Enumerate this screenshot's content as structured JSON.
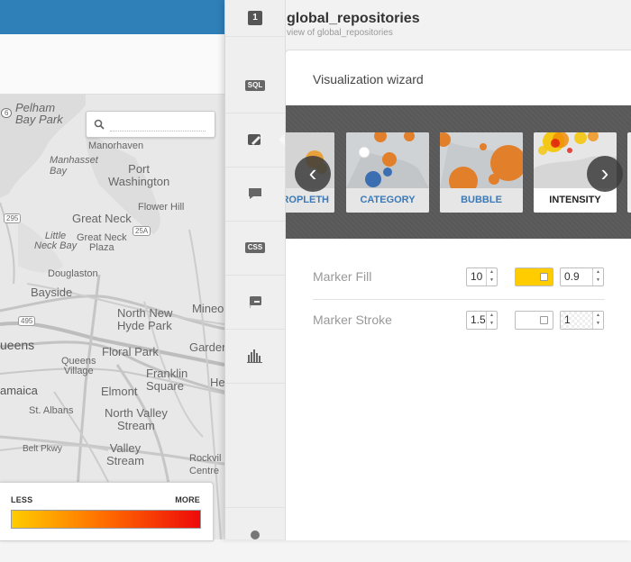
{
  "map": {
    "labels": {
      "pelham_bay_park": "Pelham\nBay Park",
      "manorhaven": "Manorhaven",
      "manhasset_bay": "Manhasset\nBay",
      "port_washington": "Port\nWashington",
      "flower_hill": "Flower Hill",
      "great_neck": "Great Neck",
      "little_neck_bay": "Little\nNeck Bay",
      "great_neck_plaza": "Great Neck\nPlaza",
      "douglaston": "Douglaston",
      "bayside": "Bayside",
      "north_new_hyde_park": "North New\nHyde Park",
      "mineola": "Mineol",
      "queens": "ueens",
      "floral_park": "Floral Park",
      "garden": "Garden",
      "queens_village": "Queens\nVillage",
      "franklin_square": "Franklin\nSquare",
      "jamaica": "amaica",
      "elmont": "Elmont",
      "he": "He",
      "st_albans": "St. Albans",
      "north_valley_stream": "North Valley\nStream",
      "valley_stream": "Valley\nStream",
      "rockville_centre": "Rockvil\nCentre",
      "belt_pkwy": "Belt Pkwy",
      "shield_295": "295",
      "shield_25a": "25A",
      "shield_495": "495",
      "shield_6": "6"
    },
    "search": {
      "placeholder": ""
    },
    "legend": {
      "less": "LESS",
      "more": "MORE"
    }
  },
  "toolbar": {
    "layer_number": "1",
    "sql": "SQL",
    "css": "CSS"
  },
  "panel": {
    "title": "global_repositories",
    "subtitle": "view of global_repositories"
  },
  "wizard": {
    "title": "Visualization wizard",
    "cards": [
      {
        "label": "ROPLETH"
      },
      {
        "label": "CATEGORY"
      },
      {
        "label": "BUBBLE"
      },
      {
        "label": "INTENSITY",
        "selected": true
      }
    ]
  },
  "properties": {
    "marker_fill": {
      "label": "Marker Fill",
      "width": "10",
      "color": "#ffcc00",
      "opacity": "0.9"
    },
    "marker_stroke": {
      "label": "Marker Stroke",
      "width": "1.5",
      "color": "#ffffff",
      "opacity": "1"
    }
  }
}
